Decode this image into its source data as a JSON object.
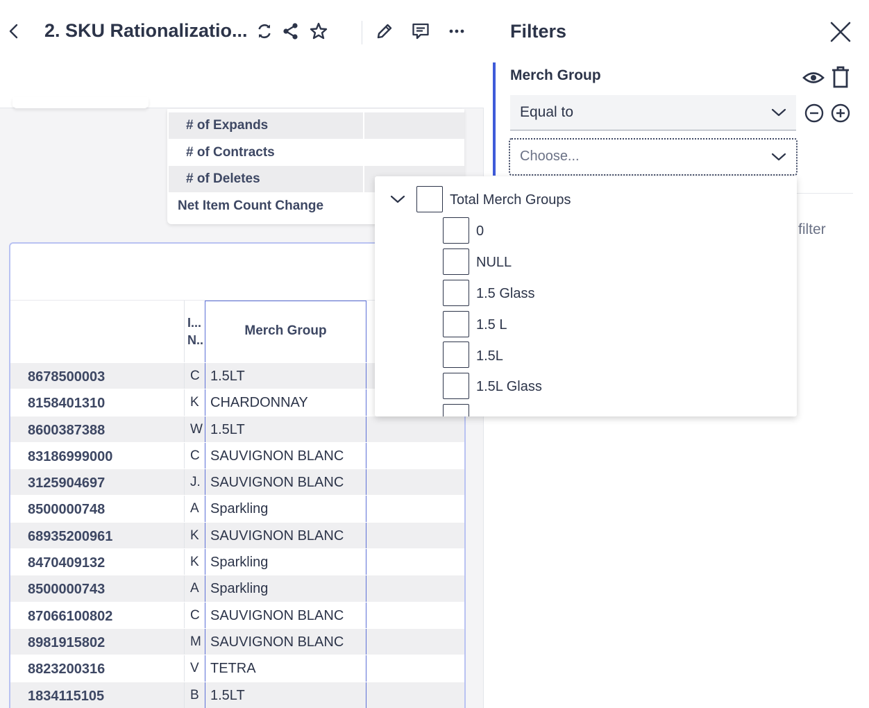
{
  "header": {
    "title": "2. SKU Rationalizatio...",
    "icons": [
      "back-icon",
      "refresh-icon",
      "share-icon",
      "star-icon",
      "edit-icon",
      "comment-icon",
      "more-icon"
    ]
  },
  "summary": {
    "rows": [
      "# of Expands",
      "# of Contracts",
      "# of Deletes",
      "Net Item Count Change"
    ]
  },
  "table": {
    "col_inv_header": "I... N..",
    "col_merch_header": "Merch Group",
    "rows": [
      {
        "id": "8678500003",
        "c2": "C",
        "merch": "1.5LT"
      },
      {
        "id": "8158401310",
        "c2": "K",
        "merch": "CHARDONNAY"
      },
      {
        "id": "8600387388",
        "c2": "W",
        "merch": "1.5LT"
      },
      {
        "id": "83186999000",
        "c2": "C",
        "merch": "SAUVIGNON BLANC"
      },
      {
        "id": "3125904697",
        "c2": "J.",
        "merch": "SAUVIGNON BLANC"
      },
      {
        "id": "8500000748",
        "c2": "A",
        "merch": "Sparkling"
      },
      {
        "id": "68935200961",
        "c2": "K",
        "merch": "SAUVIGNON BLANC"
      },
      {
        "id": "8470409132",
        "c2": "K",
        "merch": "Sparkling"
      },
      {
        "id": "8500000743",
        "c2": "A",
        "merch": "Sparkling"
      },
      {
        "id": "87066100802",
        "c2": "C",
        "merch": "SAUVIGNON BLANC"
      },
      {
        "id": "8981915802",
        "c2": "M",
        "merch": "SAUVIGNON BLANC"
      },
      {
        "id": "8823200316",
        "c2": "V",
        "merch": "TETRA"
      },
      {
        "id": "1834115105",
        "c2": "B",
        "merch": "1.5LT"
      }
    ]
  },
  "filters": {
    "title": "Filters",
    "group_label": "Merch Group",
    "operator": "Equal to",
    "choose_placeholder": "Choose...",
    "partial_text": "filter",
    "colors": {
      "accent": "#3f5bd9",
      "selected_column_border": "#5b6fd6"
    }
  },
  "dropdown": {
    "root_label": "Total Merch Groups",
    "options": [
      "0",
      "NULL",
      "1.5 Glass",
      "1.5 L",
      "1.5L",
      "1.5L Glass"
    ]
  }
}
